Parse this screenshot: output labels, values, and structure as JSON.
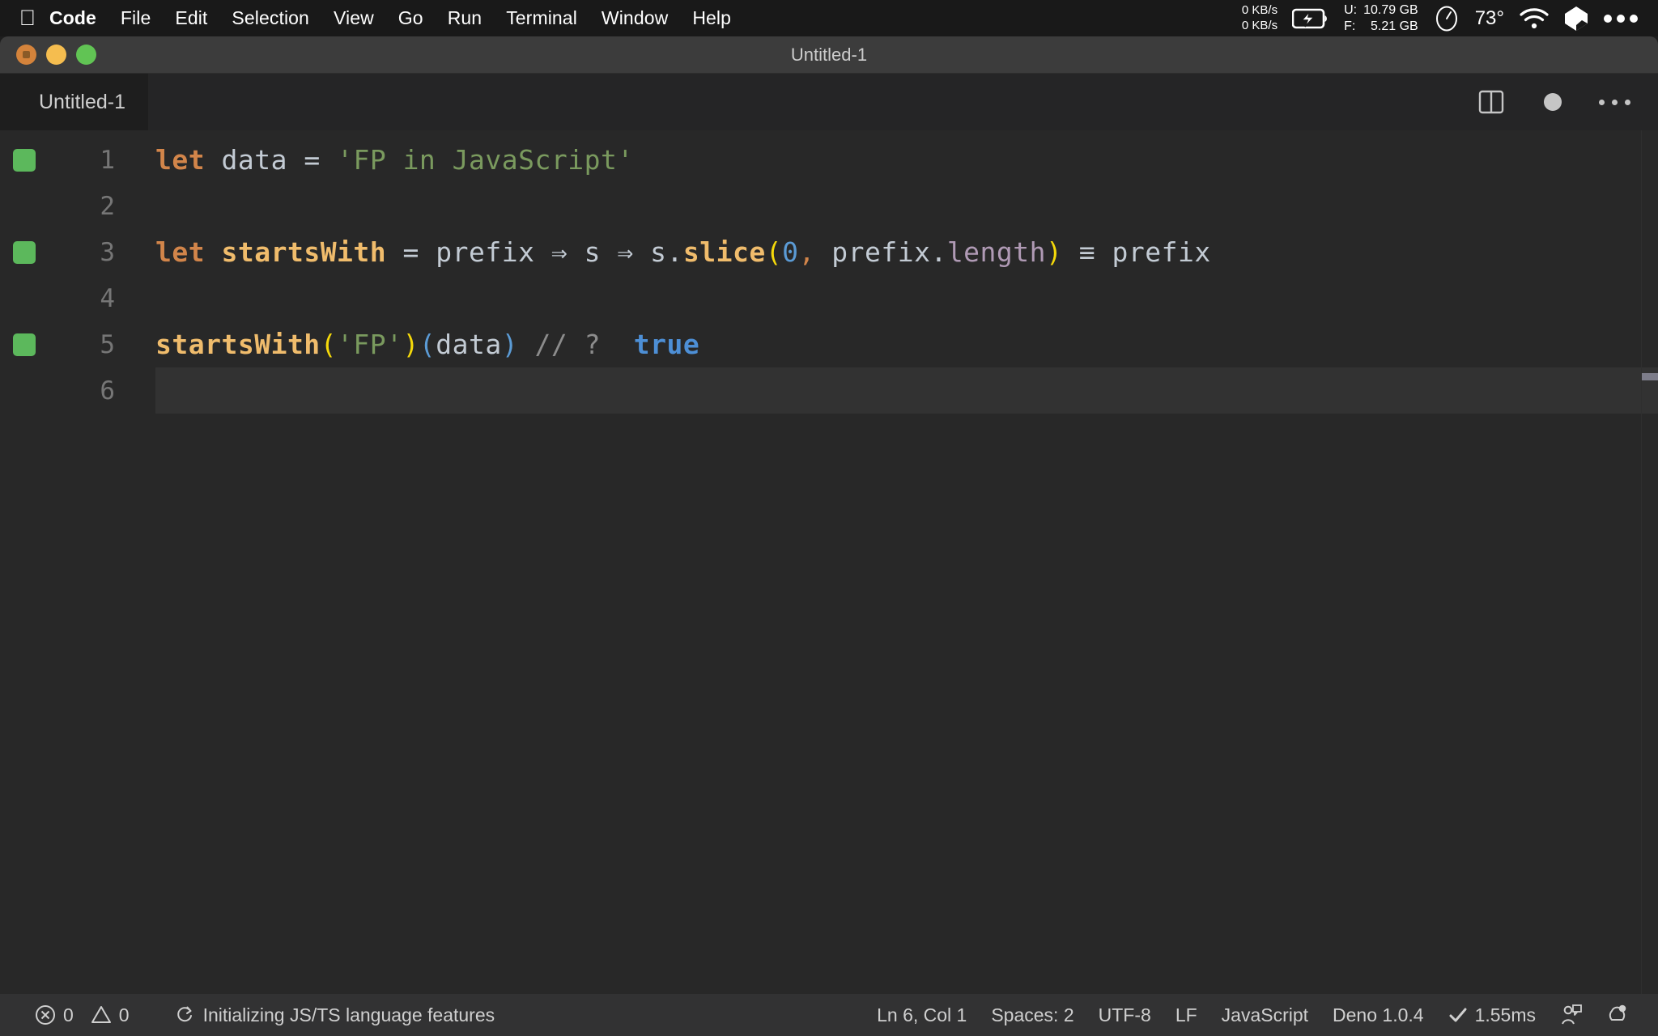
{
  "macos_menubar": {
    "apple_icon": "apple-logo-icon",
    "items": [
      {
        "label": "Code",
        "bold": true
      },
      {
        "label": "File",
        "bold": false
      },
      {
        "label": "Edit",
        "bold": false
      },
      {
        "label": "Selection",
        "bold": false
      },
      {
        "label": "View",
        "bold": false
      },
      {
        "label": "Go",
        "bold": false
      },
      {
        "label": "Run",
        "bold": false
      },
      {
        "label": "Terminal",
        "bold": false
      },
      {
        "label": "Window",
        "bold": false
      },
      {
        "label": "Help",
        "bold": false
      }
    ],
    "network": {
      "upload": "0 KB/s",
      "download": "0 KB/s"
    },
    "battery_icon": "battery-charging-icon",
    "memory": {
      "used_label": "U:",
      "used_value": "10.79 GB",
      "free_label": "F:",
      "free_value": "5.21 GB"
    },
    "clock_icon": "clock-icon",
    "temperature": "73°",
    "wifi_icon": "wifi-icon",
    "extra_icon": "cube-icon",
    "control_center_icon": "ellipsis-icon"
  },
  "window": {
    "title": "Untitled-1",
    "traffic_lights": [
      "close",
      "minimize",
      "maximize"
    ]
  },
  "tabs": [
    {
      "label": "Untitled-1",
      "active": true,
      "dirty": true
    }
  ],
  "tab_actions": {
    "split_editor_icon": "split-editor-icon",
    "dirty_indicator_icon": "unsaved-dot-icon",
    "more_actions_icon": "more-actions-ellipsis-icon"
  },
  "editor": {
    "language": "JavaScript",
    "lines": [
      {
        "number": "1",
        "coverage": true,
        "current": false,
        "tokens": [
          {
            "text": "let",
            "cls": "t-kw"
          },
          {
            "text": " ",
            "cls": "t-var"
          },
          {
            "text": "data",
            "cls": "t-var"
          },
          {
            "text": " ",
            "cls": "t-var"
          },
          {
            "text": "=",
            "cls": "t-op"
          },
          {
            "text": " ",
            "cls": "t-var"
          },
          {
            "text": "'FP in JavaScript'",
            "cls": "t-str"
          }
        ]
      },
      {
        "number": "2",
        "coverage": false,
        "current": false,
        "tokens": []
      },
      {
        "number": "3",
        "coverage": true,
        "current": false,
        "tokens": [
          {
            "text": "let",
            "cls": "t-kw"
          },
          {
            "text": " ",
            "cls": "t-var"
          },
          {
            "text": "startsWith",
            "cls": "t-fn"
          },
          {
            "text": " ",
            "cls": "t-var"
          },
          {
            "text": "=",
            "cls": "t-op"
          },
          {
            "text": " ",
            "cls": "t-var"
          },
          {
            "text": "prefix",
            "cls": "t-var"
          },
          {
            "text": " ",
            "cls": "t-var"
          },
          {
            "text": "⇒",
            "cls": "t-op"
          },
          {
            "text": " ",
            "cls": "t-var"
          },
          {
            "text": "s",
            "cls": "t-var"
          },
          {
            "text": " ",
            "cls": "t-var"
          },
          {
            "text": "⇒",
            "cls": "t-op"
          },
          {
            "text": " ",
            "cls": "t-var"
          },
          {
            "text": "s.",
            "cls": "t-var"
          },
          {
            "text": "slice",
            "cls": "t-fnbold"
          },
          {
            "text": "(",
            "cls": "t-paren-y"
          },
          {
            "text": "0",
            "cls": "t-num"
          },
          {
            "text": ",",
            "cls": "t-punct"
          },
          {
            "text": " ",
            "cls": "t-var"
          },
          {
            "text": "prefix.",
            "cls": "t-var"
          },
          {
            "text": "length",
            "cls": "t-prop"
          },
          {
            "text": ")",
            "cls": "t-paren-y"
          },
          {
            "text": " ",
            "cls": "t-var"
          },
          {
            "text": "≡",
            "cls": "t-op"
          },
          {
            "text": " ",
            "cls": "t-var"
          },
          {
            "text": "prefix",
            "cls": "t-var"
          }
        ],
        "source": "let startsWith = prefix => s => s.slice(0, prefix.length) === prefix"
      },
      {
        "number": "4",
        "coverage": false,
        "current": false,
        "tokens": []
      },
      {
        "number": "5",
        "coverage": true,
        "current": false,
        "tokens": [
          {
            "text": "startsWith",
            "cls": "t-fn"
          },
          {
            "text": "(",
            "cls": "t-paren-y"
          },
          {
            "text": "'FP'",
            "cls": "t-str"
          },
          {
            "text": ")",
            "cls": "t-paren-y"
          },
          {
            "text": "(",
            "cls": "t-paren-b"
          },
          {
            "text": "data",
            "cls": "t-var"
          },
          {
            "text": ")",
            "cls": "t-paren-b"
          },
          {
            "text": " ",
            "cls": "t-var"
          },
          {
            "text": "// ?",
            "cls": "t-comment"
          },
          {
            "text": "  ",
            "cls": "t-var"
          },
          {
            "text": "true",
            "cls": "t-result"
          }
        ],
        "source": "startsWith('FP')(data) // ?  true"
      },
      {
        "number": "6",
        "coverage": false,
        "current": true,
        "tokens": []
      }
    ]
  },
  "statusbar": {
    "errors_icon": "error-circle-icon",
    "errors_count": "0",
    "warnings_icon": "warning-triangle-icon",
    "warnings_count": "0",
    "sync_icon": "sync-spinner-icon",
    "status_message": "Initializing JS/TS language features",
    "cursor_position": "Ln 6, Col 1",
    "indentation": "Spaces: 2",
    "encoding": "UTF-8",
    "eol": "LF",
    "language_mode": "JavaScript",
    "runtime": "Deno 1.0.4",
    "quokka_check_icon": "checkmark-icon",
    "quokka_time": "1.55ms",
    "feedback_icon": "feedback-person-icon",
    "notifications_icon": "bell-icon"
  },
  "colors": {
    "menubar_bg": "#191919",
    "titlebar_bg": "#3c3c3c",
    "tabbar_bg": "#252526",
    "editor_bg": "#282828",
    "statusbar_bg": "#323233",
    "coverage_green": "#5cb85c",
    "keyword_orange": "#d2854a",
    "string_green": "#7a9a5e",
    "function_yellow": "#f0bc6c",
    "result_blue": "#4d8fd6",
    "comment_gray": "#8c8c8c",
    "property_purple": "#b09ab5",
    "paren_yellow": "#f5d90a",
    "paren_blue": "#5b9bd5"
  }
}
